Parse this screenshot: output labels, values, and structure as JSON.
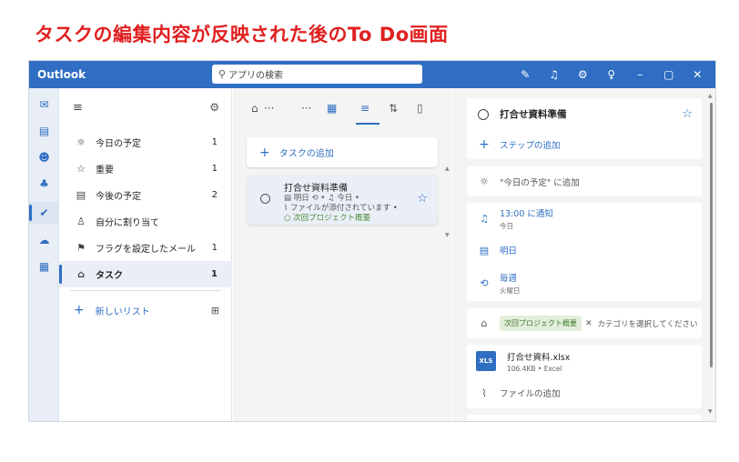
{
  "caption": "タスクの編集内容が反映された後のTo Do画面",
  "titlebar": {
    "app_title": "Outlook",
    "search_placeholder": "アプリの検索",
    "icons": [
      "compose-icon",
      "bell-icon",
      "gear-icon",
      "lightbulb-icon",
      "minimize-icon",
      "maximize-icon",
      "close-icon"
    ]
  },
  "rail": {
    "items": [
      "mail-icon",
      "calendar-icon",
      "people-icon",
      "teams-icon",
      "todo-icon",
      "onedrive-icon",
      "apps-icon"
    ],
    "active": "todo-icon"
  },
  "sidebar": {
    "items": [
      {
        "icon": "sun-icon",
        "label": "今日の予定",
        "count": "1"
      },
      {
        "icon": "star-icon",
        "label": "重要",
        "count": "1"
      },
      {
        "icon": "calendar-grid-icon",
        "label": "今後の予定",
        "count": "2"
      },
      {
        "icon": "person-icon",
        "label": "自分に割り当て",
        "count": ""
      },
      {
        "icon": "flag-icon",
        "label": "フラグを設定したメール",
        "count": "1"
      },
      {
        "icon": "home-icon",
        "label": "タスク",
        "count": "1"
      }
    ],
    "active_index": 5,
    "new_list_label": "新しいリスト"
  },
  "middle": {
    "add_task_label": "タスクの追加",
    "task": {
      "title": "打合せ資料準備",
      "meta_due": "明日",
      "meta_reminder": "今日",
      "meta_attachment": "ファイルが添付されています",
      "category": "次回プロジェクト概要"
    }
  },
  "detail": {
    "title": "打合せ資料準備",
    "add_step": "ステップの追加",
    "add_to_today": "\"今日の予定\" に追加",
    "reminder": "13:00 に通知",
    "reminder_sub": "今日",
    "due": "明日",
    "repeat": "毎週",
    "repeat_sub": "火曜日",
    "category_chip": "次回プロジェクト概要",
    "category_prompt": "カテゴリを選択してください",
    "file_badge": "XLS",
    "file_name": "打合せ資料.xlsx",
    "file_size": "106.4KB",
    "file_type": "Excel",
    "add_file": "ファイルの追加"
  },
  "colors": {
    "accent": "#2f6ec2",
    "caption": "#e02020",
    "category_green": "#3f7a2e"
  }
}
